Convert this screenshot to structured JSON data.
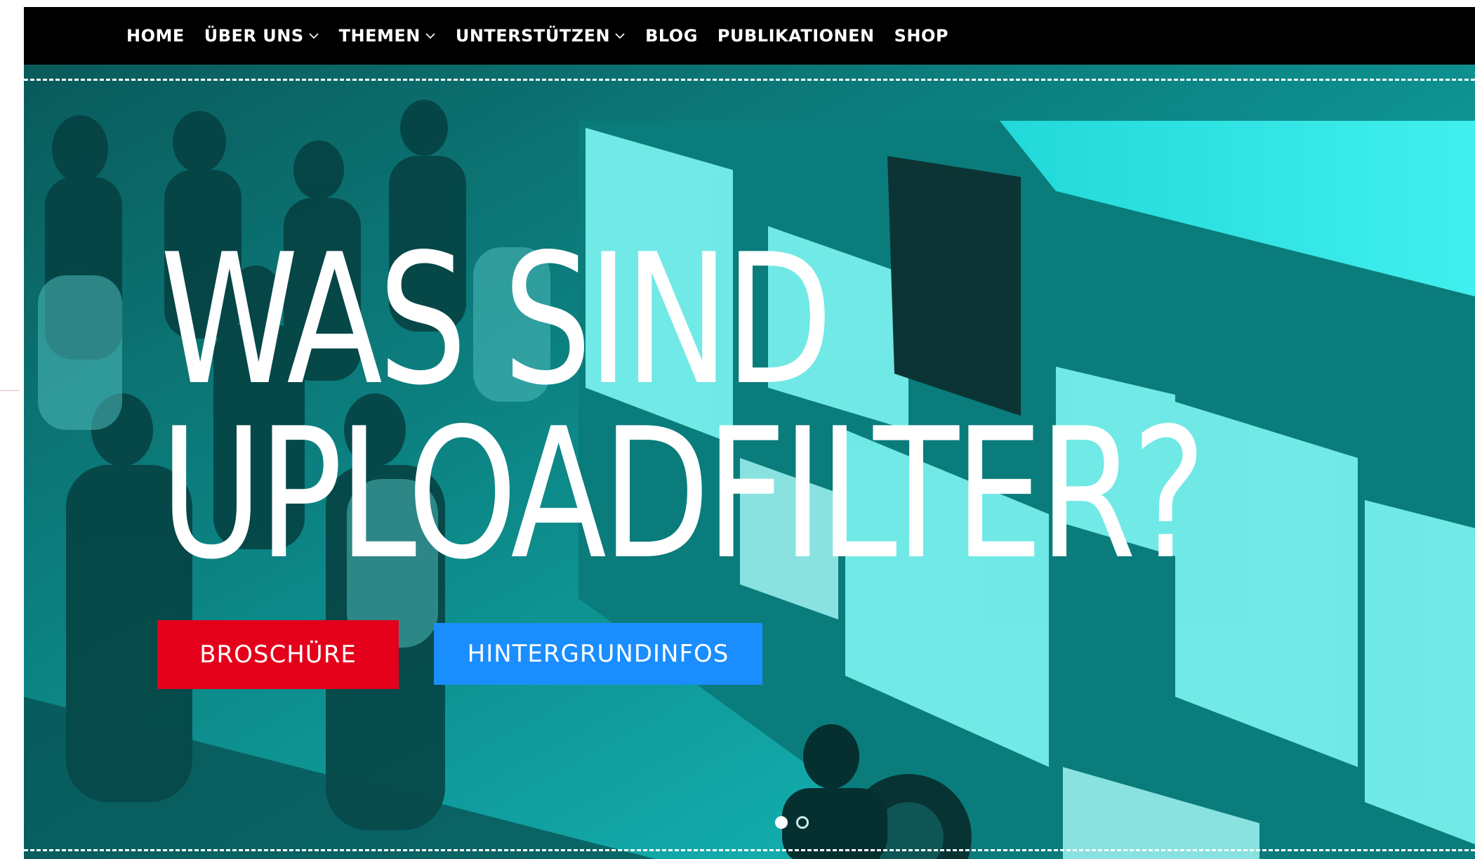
{
  "nav": {
    "items": [
      {
        "label": "HOME",
        "has_dropdown": false
      },
      {
        "label": "ÜBER UNS",
        "has_dropdown": true
      },
      {
        "label": "THEMEN",
        "has_dropdown": true
      },
      {
        "label": "UNTERSTÜTZEN",
        "has_dropdown": true
      },
      {
        "label": "BLOG",
        "has_dropdown": false
      },
      {
        "label": "PUBLIKATIONEN",
        "has_dropdown": false
      },
      {
        "label": "SHOP",
        "has_dropdown": false
      }
    ]
  },
  "hero": {
    "headline_line1": "WAS SIND",
    "headline_line2": "UPLOADFILTER?",
    "buttons": {
      "primary": "BROSCHÜRE",
      "secondary": "HINTERGRUNDINFOS"
    },
    "slider": {
      "total": 2,
      "active_index": 0
    }
  },
  "colors": {
    "nav_bg": "#000000",
    "hero_tint": "#00c8c8",
    "button_red": "#e4001b",
    "button_blue": "#1a8eff"
  },
  "icons": {
    "dropdown": "chevron-down-icon",
    "slider_dot": "dot-icon"
  }
}
